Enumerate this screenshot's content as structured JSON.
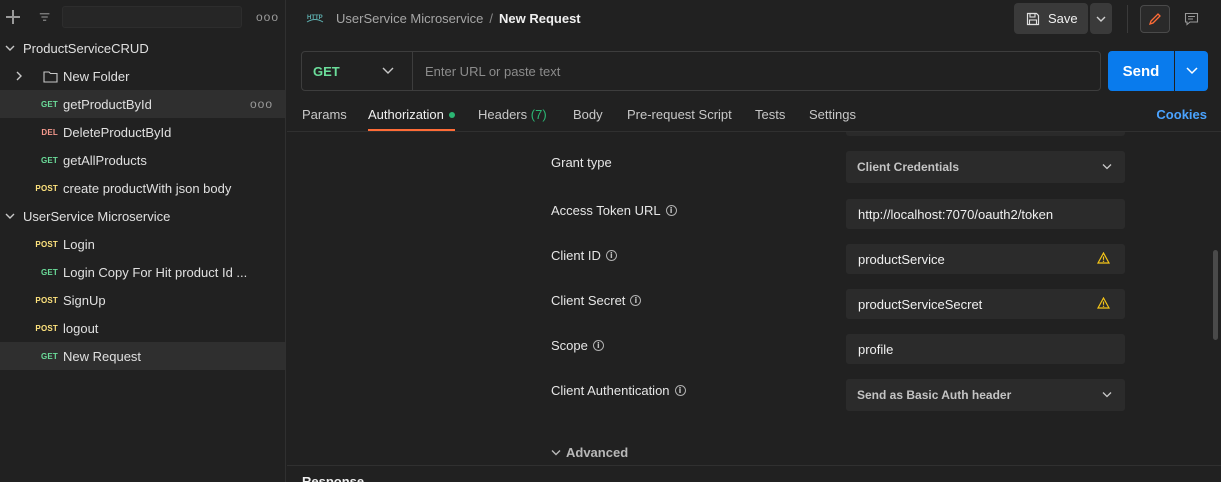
{
  "sidebar": {
    "filter_placeholder": "",
    "more": "ooo",
    "items": [
      {
        "type": "collection",
        "label": "ProductServiceCRUD",
        "expanded": true
      },
      {
        "type": "folder",
        "label": "New Folder",
        "expanded": false
      },
      {
        "type": "request",
        "method": "GET",
        "label": "getProductById",
        "selected": true,
        "more": "ooo"
      },
      {
        "type": "request",
        "method": "DEL",
        "label": "DeleteProductById"
      },
      {
        "type": "request",
        "method": "GET",
        "label": "getAllProducts"
      },
      {
        "type": "request",
        "method": "POST",
        "label": "create productWith json body"
      },
      {
        "type": "collection",
        "label": "UserService Microservice",
        "expanded": true
      },
      {
        "type": "request",
        "method": "POST",
        "label": "Login"
      },
      {
        "type": "request",
        "method": "GET",
        "label": "Login Copy For Hit product Id ..."
      },
      {
        "type": "request",
        "method": "POST",
        "label": "SignUp"
      },
      {
        "type": "request",
        "method": "POST",
        "label": "logout"
      },
      {
        "type": "request",
        "method": "GET",
        "label": "New Request",
        "selected": true
      }
    ]
  },
  "header": {
    "icon": "http-icon",
    "collection": "UserService Microservice",
    "separator": "/",
    "request_name": "New Request",
    "save_label": "Save"
  },
  "request": {
    "method": "GET",
    "url_placeholder": "Enter URL or paste text",
    "send_label": "Send"
  },
  "tabs": {
    "items": [
      "Params",
      "Authorization",
      "Headers",
      "Body",
      "Pre-request Script",
      "Tests",
      "Settings"
    ],
    "headers_count": "(7)",
    "active": "Authorization",
    "cookies": "Cookies"
  },
  "auth_form": {
    "grant_type": {
      "label": "Grant type",
      "value": "Client Credentials"
    },
    "access_token_url": {
      "label": "Access Token URL",
      "value": "http://localhost:7070/oauth2/token"
    },
    "client_id": {
      "label": "Client ID",
      "value": "productService"
    },
    "client_secret": {
      "label": "Client Secret",
      "value": "productServiceSecret"
    },
    "scope": {
      "label": "Scope",
      "value": "profile"
    },
    "client_authentication": {
      "label": "Client Authentication",
      "value": "Send as Basic Auth header"
    },
    "advanced": "Advanced"
  },
  "response": {
    "title": "Response"
  },
  "colors": {
    "get": "#6bdd9a",
    "post": "#ffe47e",
    "delete": "#f79a8e",
    "send": "#097bed",
    "active_tab_underline": "#ff6c37",
    "cookies_link": "#4aa3ff",
    "warning": "#f5c518"
  }
}
